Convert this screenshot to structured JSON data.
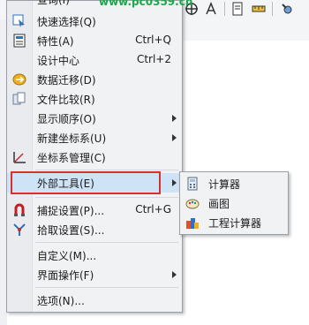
{
  "toolbar": {
    "icons": [
      "crosshair-icon",
      "text-style-icon",
      "panel-icon",
      "measure-icon",
      "tool-icon"
    ]
  },
  "menu": {
    "partial_top_label": "查询(I)",
    "items": [
      {
        "label": "快速选择(Q)",
        "shortcut": "",
        "submenu": false,
        "icon": "quick-select-icon"
      },
      {
        "label": "特性(A)",
        "shortcut": "Ctrl+Q",
        "submenu": false,
        "icon": "properties-icon"
      },
      {
        "label": "设计中心",
        "shortcut": "Ctrl+2",
        "submenu": false,
        "icon": ""
      },
      {
        "label": "数据迁移(D)",
        "shortcut": "",
        "submenu": false,
        "icon": "data-migration-icon"
      },
      {
        "label": "文件比较(R)",
        "shortcut": "",
        "submenu": false,
        "icon": "file-compare-icon"
      },
      {
        "label": "显示顺序(O)",
        "shortcut": "",
        "submenu": true,
        "icon": ""
      },
      {
        "label": "新建坐标系(U)",
        "shortcut": "",
        "submenu": true,
        "icon": ""
      },
      {
        "label": "坐标系管理(C)",
        "shortcut": "",
        "submenu": false,
        "icon": "ucs-manager-icon"
      },
      {
        "label": "外部工具(E)",
        "shortcut": "",
        "submenu": true,
        "icon": ""
      },
      {
        "label": "捕捉设置(P)...",
        "shortcut": "Ctrl+G",
        "submenu": false,
        "icon": "snap-settings-icon"
      },
      {
        "label": "拾取设置(S)...",
        "shortcut": "",
        "submenu": false,
        "icon": "pick-settings-icon"
      },
      {
        "label": "自定义(M)...",
        "shortcut": "",
        "submenu": false,
        "icon": ""
      },
      {
        "label": "界面操作(F)",
        "shortcut": "",
        "submenu": true,
        "icon": ""
      },
      {
        "label": "选项(N)...",
        "shortcut": "",
        "submenu": false,
        "icon": ""
      }
    ]
  },
  "submenu": {
    "items": [
      {
        "label": "计算器",
        "icon": "calculator-icon"
      },
      {
        "label": "画图",
        "icon": "paint-icon"
      },
      {
        "label": "工程计算器",
        "icon": "engineering-calculator-icon"
      }
    ]
  },
  "colors": {
    "highlight_border": "#d9302e",
    "highlight_fill": "#cfe3f7"
  }
}
